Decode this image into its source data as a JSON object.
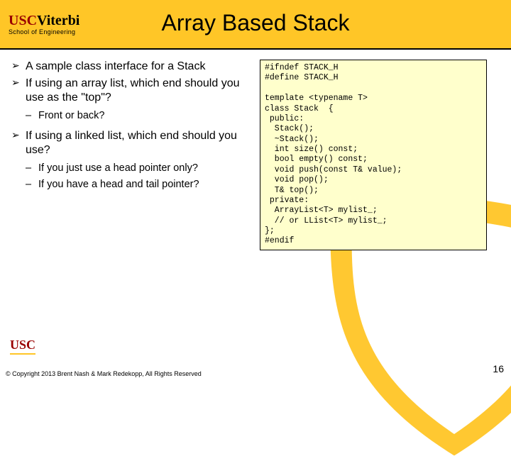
{
  "header": {
    "logo_usc": "USC",
    "logo_viterbi": "Viterbi",
    "logo_sub": "School of Engineering",
    "title": "Array Based Stack"
  },
  "bullets": {
    "b1": "A sample class interface for a Stack",
    "b2": "If using an array list, which end should you use as the \"top\"?",
    "b2s1": "Front or back?",
    "b3": "If using a linked list, which end should you use?",
    "b3s1": "If you just use a head pointer only?",
    "b3s2": "If you have a head and tail pointer?"
  },
  "code": "#ifndef STACK_H\n#define STACK_H\n\ntemplate <typename T>\nclass Stack  {\n public:\n  Stack();\n  ~Stack();\n  int size() const;\n  bool empty() const;\n  void push(const T& value);\n  void pop();\n  T& top();\n private:\n  ArrayList<T> mylist_;\n  // or LList<T> mylist_;\n};\n#endif",
  "footer": {
    "logo": "USC",
    "copyright": "© Copyright 2013 Brent Nash & Mark Redekopp, All Rights Reserved",
    "page": "16"
  }
}
